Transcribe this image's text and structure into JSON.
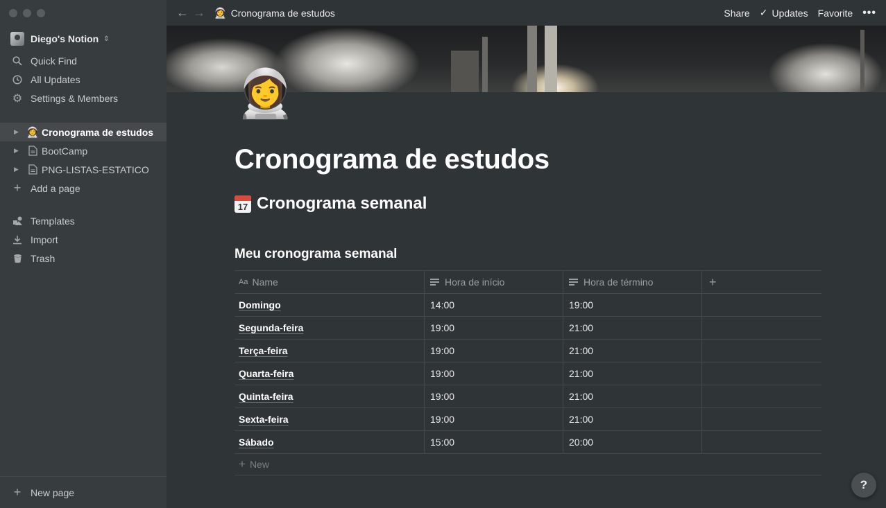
{
  "workspace": {
    "name": "Diego's Notion"
  },
  "sidebar": {
    "top_items": [
      {
        "label": "Quick Find",
        "icon": "search-icon"
      },
      {
        "label": "All Updates",
        "icon": "clock-icon"
      },
      {
        "label": "Settings & Members",
        "icon": "gear-icon"
      }
    ],
    "pages": [
      {
        "label": "Cronograma de estudos",
        "icon": "astronaut-emoji",
        "active": true
      },
      {
        "label": "BootCamp",
        "icon": "page-icon"
      },
      {
        "label": "PNG-LISTAS-ESTATICO",
        "icon": "page-icon"
      }
    ],
    "add_page": "Add a page",
    "bottom_items": [
      {
        "label": "Templates",
        "icon": "templates-icon"
      },
      {
        "label": "Import",
        "icon": "download-icon"
      },
      {
        "label": "Trash",
        "icon": "trash-icon"
      }
    ],
    "new_page": "New page"
  },
  "topbar": {
    "breadcrumb": "Cronograma de estudos",
    "share": "Share",
    "updates": "Updates",
    "favorite": "Favorite",
    "more": "•••"
  },
  "page": {
    "title": "Cronograma de estudos",
    "heading": "Cronograma semanal",
    "heading_calendar_day": "17",
    "database_title": "Meu cronograma semanal"
  },
  "table": {
    "columns": [
      "Name",
      "Hora de início",
      "Hora de término"
    ],
    "rows": [
      [
        "Domingo",
        "14:00",
        "19:00"
      ],
      [
        "Segunda-feira",
        "19:00",
        "21:00"
      ],
      [
        "Terça-feira",
        "19:00",
        "21:00"
      ],
      [
        "Quarta-feira",
        "19:00",
        "21:00"
      ],
      [
        "Quinta-feira",
        "19:00",
        "21:00"
      ],
      [
        "Sexta-feira",
        "19:00",
        "21:00"
      ],
      [
        "Sábado",
        "15:00",
        "20:00"
      ]
    ],
    "new_label": "New"
  },
  "help": "?"
}
